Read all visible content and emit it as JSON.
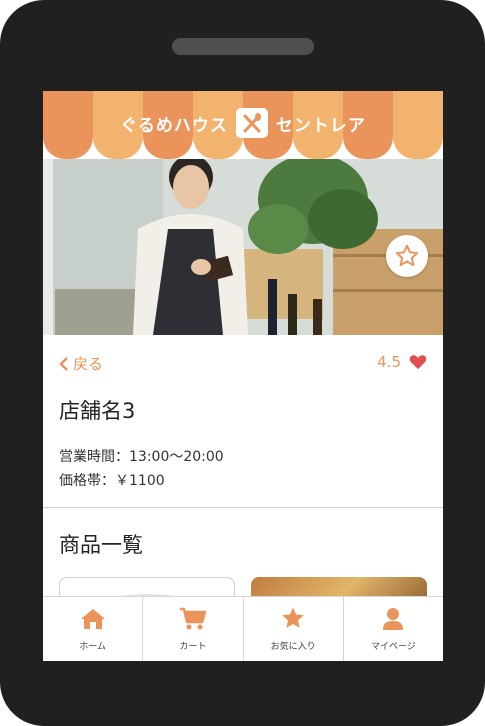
{
  "header": {
    "brand_left": "ぐるめハウス",
    "brand_right": "セントレア"
  },
  "shop": {
    "back_label": "戻る",
    "rating": "4.5",
    "name": "店舗名3",
    "hours": "営業時間：13:00〜20:00",
    "price": "価格帯：￥1100"
  },
  "products": {
    "title": "商品一覧"
  },
  "tabs": [
    {
      "label": "ホーム",
      "icon": "home-icon"
    },
    {
      "label": "カート",
      "icon": "cart-icon"
    },
    {
      "label": "お気に入り",
      "icon": "star-icon"
    },
    {
      "label": "マイページ",
      "icon": "user-icon"
    }
  ],
  "colors": {
    "accent": "#ea935a",
    "accent_light": "#f2b36f",
    "heart": "#e05050",
    "frame": "#202020"
  }
}
